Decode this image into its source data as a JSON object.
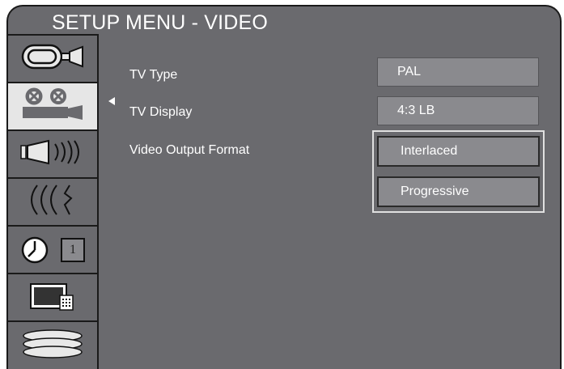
{
  "window": {
    "title": "SETUP MENU - VIDEO"
  },
  "sidebar": {
    "items": [
      {
        "icon": "video-camera-icon",
        "active": false
      },
      {
        "icon": "film-projector-icon",
        "active": true
      },
      {
        "icon": "speaker-icon",
        "active": false
      },
      {
        "icon": "waves-icon",
        "active": false
      },
      {
        "icon": "clock-icon",
        "clock_digit": "1",
        "active": false
      },
      {
        "icon": "tv-remote-icon",
        "active": false
      },
      {
        "icon": "disc-stack-icon",
        "active": false
      }
    ]
  },
  "settings": [
    {
      "label": "TV Type",
      "value": "PAL"
    },
    {
      "label": "TV Display",
      "value": "4:3 LB"
    },
    {
      "label": "Video Output Format"
    }
  ],
  "video_output_options": [
    "Interlaced",
    "Progressive"
  ],
  "colors": {
    "panel": "#6a6a6e",
    "field": "#8a8a8e",
    "text": "#ffffff",
    "active_tab": "#e6e6e6"
  }
}
